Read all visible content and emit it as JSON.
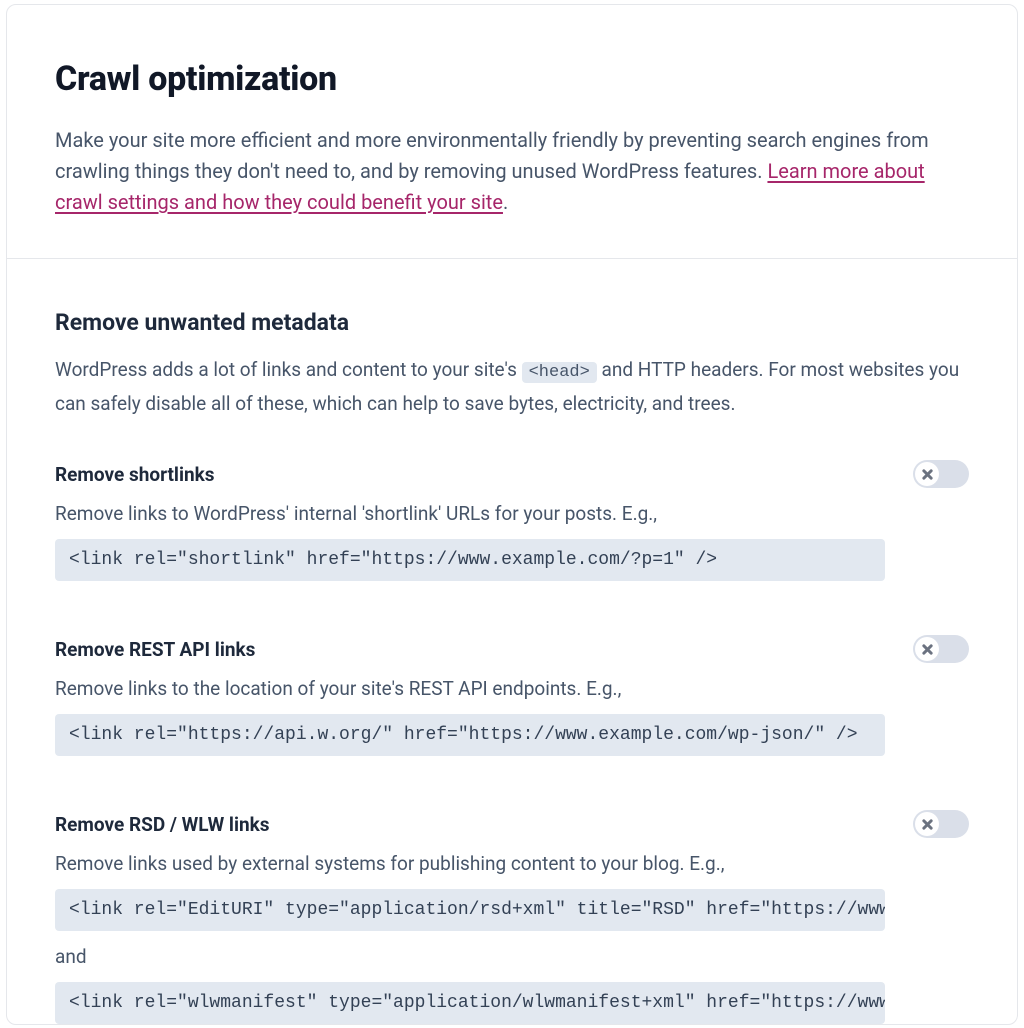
{
  "header": {
    "title": "Crawl optimization",
    "lead_before": "Make your site more efficient and more environmentally friendly by preventing search engines from crawling things they don't need to, and by removing unused WordPress features. ",
    "learn_link": "Learn more about crawl settings and how they could benefit your site",
    "lead_after": "."
  },
  "subsection": {
    "title": "Remove unwanted metadata",
    "desc_before": "WordPress adds a lot of links and content to your site's ",
    "code_inline": "<head>",
    "desc_after": " and HTTP headers. For most websites you can safely disable all of these, which can help to save bytes, electricity, and trees."
  },
  "settings": [
    {
      "title": "Remove shortlinks",
      "desc": "Remove links to WordPress' internal 'shortlink' URLs for your posts. E.g.,",
      "code1": "<link rel=\"shortlink\" href=\"https://www.example.com/?p=1\" />",
      "toggle": false
    },
    {
      "title": "Remove REST API links",
      "desc": "Remove links to the location of your site's REST API endpoints. E.g.,",
      "code1": "<link rel=\"https://api.w.org/\" href=\"https://www.example.com/wp-json/\" />",
      "toggle": false
    },
    {
      "title": "Remove RSD / WLW links",
      "desc": "Remove links used by external systems for publishing content to your blog. E.g.,",
      "code1": "<link rel=\"EditURI\" type=\"application/rsd+xml\" title=\"RSD\" href=\"https://www.",
      "and": "and",
      "code2": "<link rel=\"wlwmanifest\" type=\"application/wlwmanifest+xml\" href=\"https://www.",
      "toggle": false
    }
  ]
}
